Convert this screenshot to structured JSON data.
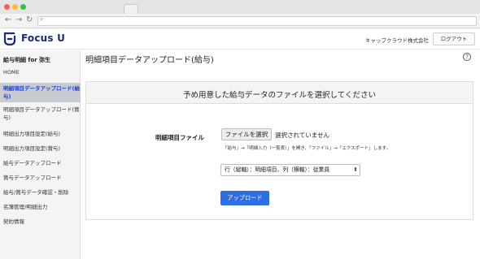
{
  "header": {
    "logo_text": "Focus U",
    "company": "キャップクラウド株式会社",
    "logout_label": "ログアウト"
  },
  "sidebar": {
    "title": "給与明細 for 弥生",
    "items": [
      {
        "label": "HOME",
        "active": false
      },
      {
        "label": "明細項目データアップロード(給与)",
        "active": true
      },
      {
        "label": "明細項目データアップロード(賞与)",
        "active": false
      },
      {
        "label": "明細出力項目設定(給与)",
        "active": false
      },
      {
        "label": "明細出力項目設定(賞与)",
        "active": false
      },
      {
        "label": "給与データアップロード",
        "active": false
      },
      {
        "label": "賞与データアップロード",
        "active": false
      },
      {
        "label": "給与/賞与データ確認・削除",
        "active": false
      },
      {
        "label": "名簿管理/明細出力",
        "active": false
      },
      {
        "label": "契約情報",
        "active": false
      }
    ]
  },
  "main": {
    "title": "明細項目データアップロード(給与)",
    "help": "?",
    "panel_heading": "予め用意した給与データのファイルを選択してください",
    "field_label": "明細項目ファイル",
    "file_button": "ファイルを選択",
    "file_status": "選択されていません",
    "hint": "「給与」→「明細入力（一覧表）」を開き、「ファイル」→「エクスポート」します。",
    "select_value": "行（縦軸）：明細項目、列（横軸）：従業員",
    "upload_label": "アップロード"
  },
  "colors": {
    "brand": "#1b2a7b",
    "primary_button": "#2f6ee0",
    "active_link": "#1c44d6"
  },
  "icons": [
    "search-icon",
    "back-arrow-icon",
    "forward-arrow-icon",
    "help-icon",
    "caret-icon"
  ]
}
